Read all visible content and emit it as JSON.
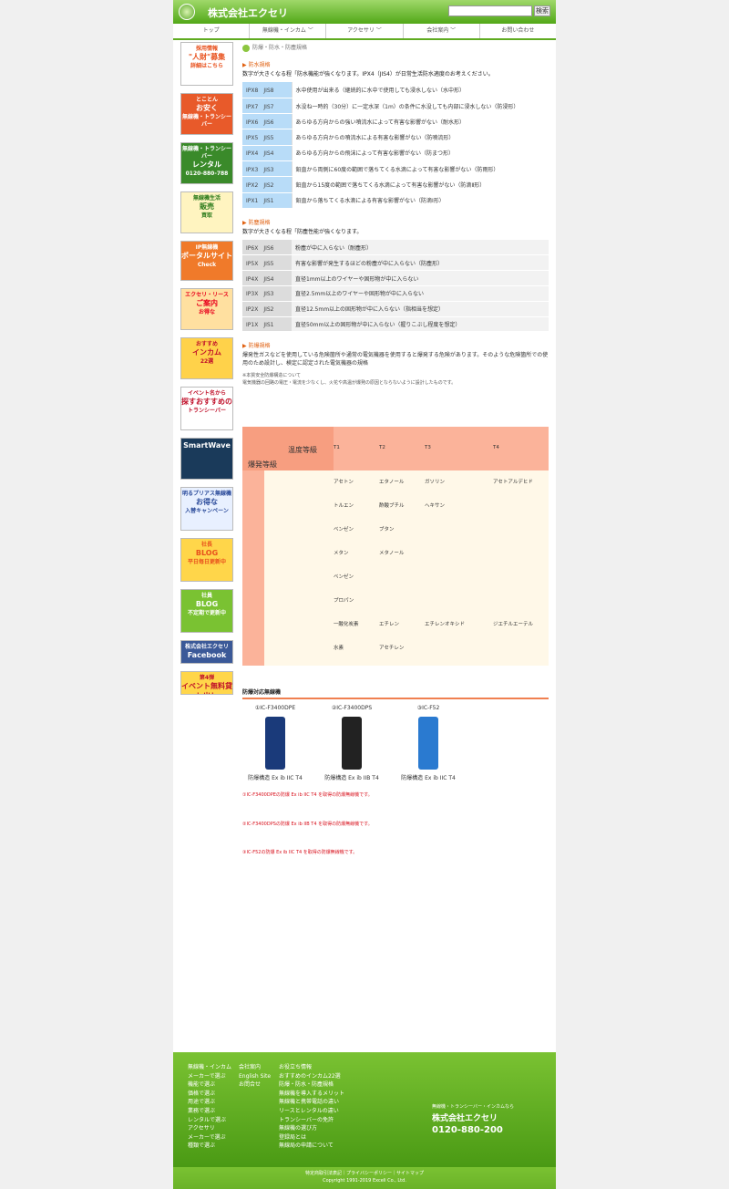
{
  "header": {
    "company": "株式会社エクセリ",
    "search_button": "検索"
  },
  "nav": [
    "トップ",
    "無線機・インカム ﹀",
    "アクセサリ ﹀",
    "会社案内 ﹀",
    "お問い合わせ"
  ],
  "sidebar": [
    {
      "l1": "採用情報",
      "l2": "\"人財\"募集",
      "l3": "詳細はこちら",
      "bg": "#ffffff",
      "accent": "#e8501c"
    },
    {
      "l1": "とことん",
      "l2": "お安く",
      "l3": "無線機・トランシーバー",
      "bg": "#e85a2a",
      "accent": "#ffffff"
    },
    {
      "l1": "無線機・トランシーバー",
      "l2": "レンタル",
      "l3": "0120-880-788",
      "bg": "#3a8a2a",
      "accent": "#ffffff"
    },
    {
      "l1": "無線機生活",
      "l2": "販売",
      "l3": "買取",
      "bg": "#fff4c0",
      "accent": "#2a7a1a"
    },
    {
      "l1": "IP無線機",
      "l2": "ポータルサイト",
      "l3": "Check",
      "bg": "#f07a2a",
      "accent": "#ffffff"
    },
    {
      "l1": "エクセリ・リース",
      "l2": "ご案内",
      "l3": "お得な",
      "bg": "#ffe0a0",
      "accent": "#e8001c"
    },
    {
      "l1": "おすすめ",
      "l2": "インカム",
      "l3": "22選",
      "bg": "#ffd24a",
      "accent": "#c0102a"
    },
    {
      "l1": "イベント名から",
      "l2": "探すおすすめの",
      "l3": "トランシーバー",
      "bg": "#ffffff",
      "accent": "#c0102a"
    },
    {
      "l1": "",
      "l2": "SmartWave",
      "l3": "",
      "bg": "#1a3a5a",
      "accent": "#ffffff"
    },
    {
      "l1": "明るプリアス無線機",
      "l2": "お得な",
      "l3": "入替キャンペーン",
      "bg": "#e8f0ff",
      "accent": "#2a4a9a"
    },
    {
      "l1": "社長",
      "l2": "BLOG",
      "l3": "平日毎日更新中",
      "bg": "#ffd64a",
      "accent": "#e8501c"
    },
    {
      "l1": "社員",
      "l2": "BLOG",
      "l3": "不定期で更新中",
      "bg": "#7ac232",
      "accent": "#ffffff"
    },
    {
      "l1": "株式会社エクセリ",
      "l2": "Facebook",
      "l3": "",
      "bg": "#3b5998",
      "accent": "#ffffff"
    },
    {
      "l1": "第4弾",
      "l2": "イベント無料貸し出し",
      "l3": "",
      "bg": "#ffd64a",
      "accent": "#c0102a"
    }
  ],
  "breadcrumb": "防爆・防水・防塵規格",
  "water": {
    "title": "防水規格",
    "desc": "数字が大きくなる程「防水機能が強くなります。IPX4（JIS4）が日常生活防水適度のお考えください。",
    "rows": [
      {
        "g": "IPX8　JIS8",
        "d": "水中使用が出来る（継続的に水中で使用しても浸水しない（水中形）"
      },
      {
        "g": "IPX7　JIS7",
        "d": "水没ね一時的（30分）に一定水深（1m）の条件に水没しても内部に浸水しない（防浸形）"
      },
      {
        "g": "IPX6　JIS6",
        "d": "あらゆる方向からの強い噴流水によって有害な影響がない（耐水形）"
      },
      {
        "g": "IPX5　JIS5",
        "d": "あらゆる方向からの噴流水による有害な影響がない（防噴流形）"
      },
      {
        "g": "IPX4　JIS4",
        "d": "あらゆる方向からの飛沫によって有害な影響がない（防まつ形）"
      },
      {
        "g": "IPX3　JIS3",
        "d": "鉛直から両側に60度の範囲で落ちてくる水滴によって有害な影響がない（防雨形）"
      },
      {
        "g": "IPX2　JIS2",
        "d": "鉛直から15度の範囲で落ちてくる水滴によって有害な影響がない（防滴Ⅱ形）"
      },
      {
        "g": "IPX1　JIS1",
        "d": "鉛直から落ちてくる水滴による有害な影響がない（防滴Ⅰ形）"
      }
    ]
  },
  "dust": {
    "title": "防塵規格",
    "desc": "数字が大きくなる程「防塵性能が強くなります。",
    "rows": [
      {
        "g": "IP6X　JIS6",
        "d": "粉塵が中に入らない（耐塵形）"
      },
      {
        "g": "IP5X　JIS5",
        "d": "有害な影響が発生するほどの粉塵が中に入らない（防塵形）"
      },
      {
        "g": "IP4X　JIS4",
        "d": "直径1mm以上のワイヤーや固形物が中に入らない"
      },
      {
        "g": "IP3X　JIS3",
        "d": "直径2.5mm以上のワイヤーや固形物が中に入らない"
      },
      {
        "g": "IP2X　JIS2",
        "d": "直径12.5mm以上の固形物が中に入らない（指相当を想定）"
      },
      {
        "g": "IP1X　JIS1",
        "d": "直径50mm以上の固形物が中に入らない（握りこぶし程度を想定）"
      }
    ]
  },
  "explosion": {
    "title": "防爆規格",
    "desc": "爆発性ガスなどを使用している危険箇所や通常の電気機器を使用すると爆発する危険があります。そのような危険箇所での使用のため設計し、検定に認定された電気機器の規格",
    "small1": "※本質安全防爆構造について",
    "small2": "電気機器の回路の電圧・電流を少なくし、火花や高温が爆発の原因とならないように設計したものです。",
    "table_heading": "温度等級",
    "table_left": "爆発等級",
    "cols": [
      "T1",
      "T2",
      "T3",
      "T4"
    ],
    "rows": [
      [
        "アセトン",
        "エタノール",
        "ガソリン",
        "アセトアルデヒド"
      ],
      [
        "トルエン",
        "酢酸ブチル",
        "ヘキサン",
        ""
      ],
      [
        "ベンゼン",
        "ブタン",
        "",
        ""
      ],
      [
        "メタン",
        "メタノール",
        "",
        ""
      ],
      [
        "ベンゼン",
        "",
        "",
        ""
      ],
      [
        "プロパン",
        "",
        "",
        ""
      ],
      [
        "一酸化炭素",
        "エチレン",
        "エチレンオキシド",
        "ジエチルエーテル"
      ],
      [
        "水素",
        "アセチレン",
        "",
        ""
      ]
    ]
  },
  "models": {
    "title": "防爆対応無線機",
    "items": [
      {
        "name": "①IC-F3400DPE",
        "label": "防爆構造 Ex ib IIC T4",
        "color": "#1a3a7a"
      },
      {
        "name": "②IC-F3400DPS",
        "label": "防爆構造 Ex ib IIB T4",
        "color": "#222222"
      },
      {
        "name": "③IC-F52",
        "label": "防爆構造 Ex ib IIC T4",
        "color": "#2a7ad0"
      }
    ]
  },
  "notes": [
    "①IC-F3400DPEの防爆 Ex ib IIC T4 を取得の防爆無線機です。",
    "②IC-F3400DPSの防爆 Ex ib IIB T4 を取得の防爆無線機です。",
    "③IC-F52の防爆 Ex ib IIC T4 を取得の防爆無線機です。"
  ],
  "footer": {
    "col1": [
      "無線機・インカム",
      "メーカーで選ぶ",
      "機能で選ぶ",
      "価格で選ぶ",
      "用途で選ぶ",
      "業務で選ぶ",
      "レンタルで選ぶ",
      "アクセサリ",
      "メーカーで選ぶ",
      "種類で選ぶ"
    ],
    "col2": [
      "会社案内",
      "English Site",
      "お問合せ"
    ],
    "col3": [
      "お役立ち情報",
      "おすすめのインカム22選",
      "防爆・防水・防塵規格",
      "無線機を導入するメリット",
      "無線機と携帯電話の違い",
      "リースとレンタルの違い",
      "トランシーバーの免許",
      "無線機の選び方",
      "登録局とは",
      "無線局の申請について"
    ],
    "tagline": "無線機・トランシーバー・インカムなら",
    "company": "株式会社エクセリ",
    "phone": "0120-880-200",
    "links": "特定商取引法表記｜プライバシーポリシー｜サイトマップ",
    "copyright": "Copyright 1991-2019 Exceli Co., Ltd."
  }
}
